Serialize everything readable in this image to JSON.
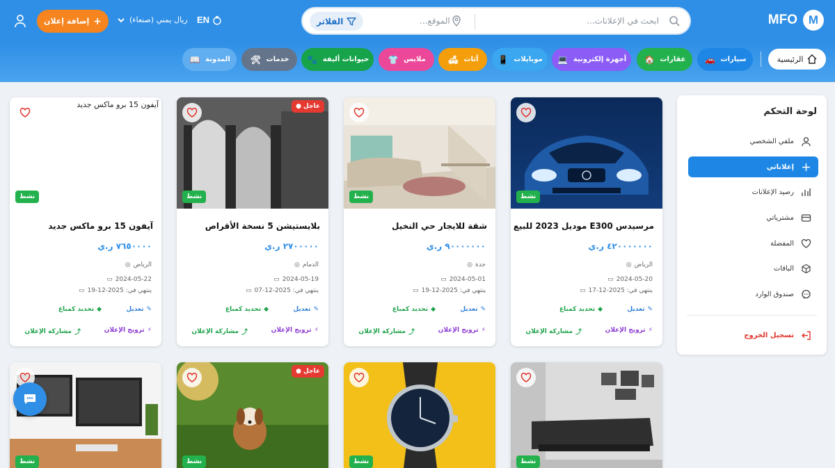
{
  "header": {
    "logo_text": "MFO",
    "logo_letter": "M",
    "search_placeholder": "ابحث في الإعلانات...",
    "location_placeholder": "الموقع...",
    "filters_label": "الفلاتر",
    "language_label": "EN",
    "currency_label": "ريال يمني (صنعاء)",
    "add_ad_label": "إضافة إعلان"
  },
  "categories": {
    "home_label": "الرئيسية",
    "items": [
      {
        "label": "سيارات",
        "icon": "car-icon",
        "bg": "#1e87e5",
        "fg": "#ffffff"
      },
      {
        "label": "عقارات",
        "icon": "house-icon",
        "bg": "#22b14c",
        "fg": "#ffffff"
      },
      {
        "label": "أجهزة إلكترونية",
        "icon": "laptop-icon",
        "bg": "#8b5cf6",
        "fg": "#ffffff"
      },
      {
        "label": "موبايلات",
        "icon": "phone-icon",
        "bg": "#3aa7f0",
        "fg": "#ffffff"
      },
      {
        "label": "أثاث",
        "icon": "sofa-icon",
        "bg": "#f59e0b",
        "fg": "#ffffff"
      },
      {
        "label": "ملابس",
        "icon": "shirt-icon",
        "bg": "#ec4899",
        "fg": "#ffffff"
      },
      {
        "label": "حيوانات أليفة",
        "icon": "paw-icon",
        "bg": "#16a34a",
        "fg": "#ffffff"
      },
      {
        "label": "خدمات",
        "icon": "tools-icon",
        "bg": "#64748b",
        "fg": "#ffffff"
      },
      {
        "label": "المدونة",
        "icon": "book-icon",
        "bg": "#60aef0",
        "fg": "#ffffff"
      }
    ]
  },
  "sidebar": {
    "title": "لوحة التحكم",
    "items": [
      {
        "label": "ملفي الشخصي",
        "icon": "user-icon",
        "active": false
      },
      {
        "label": "إعلاناتي",
        "icon": "plus-icon",
        "active": true
      },
      {
        "label": "رصيد الإعلانات",
        "icon": "bar-chart-icon",
        "active": false
      },
      {
        "label": "مشترياتي",
        "icon": "credit-card-icon",
        "active": false
      },
      {
        "label": "المفضلة",
        "icon": "heart-icon",
        "active": false
      },
      {
        "label": "الباقات",
        "icon": "package-icon",
        "active": false
      },
      {
        "label": "صندوق الوارد",
        "icon": "chat-icon",
        "active": false
      }
    ],
    "logout_label": "تسجيل الخروج"
  },
  "card_labels": {
    "active_badge": "نشط",
    "urgent_badge": "عاجل",
    "edit": "تعديل",
    "mark_sold": "تحديد كمباع",
    "promote": "ترويج الإعلان",
    "share": "مشاركة الإعلان"
  },
  "cards": [
    {
      "title": "مرسيدس E300 موديل 2023 للبيع",
      "price": "٤٢٠٠٠٠٠٠٠ ر.ي",
      "location": "الرياض",
      "posted": "2024-05-20",
      "expires": "ينتهي في: 2025-12-17",
      "urgent": false
    },
    {
      "title": "شقة للايجار حي النخيل",
      "price": "٩٠٠٠٠٠٠٠ ر.ي",
      "location": "جدة",
      "posted": "2024-05-01",
      "expires": "ينتهي في: 2025-12-19",
      "urgent": false
    },
    {
      "title": "بلايستيشن 5 نسخة الأقراص",
      "price": "٢٧٠٠٠٠٠ ر.ي",
      "location": "الدمام",
      "posted": "2024-05-19",
      "expires": "ينتهي في: 2025-12-07",
      "urgent": true
    },
    {
      "title": "آيفون 15 برو ماكس جديد",
      "price": "٧٦٥٠٠٠٠ ر.ي",
      "location": "الرياض",
      "posted": "2024-05-22",
      "expires": "ينتهي في: 2025-12-19",
      "urgent": false,
      "broken_image_alt": "آيفون 15 برو ماكس جديد"
    },
    {
      "urgent": false
    },
    {
      "urgent": false
    },
    {
      "urgent": true
    },
    {
      "urgent": false
    }
  ]
}
